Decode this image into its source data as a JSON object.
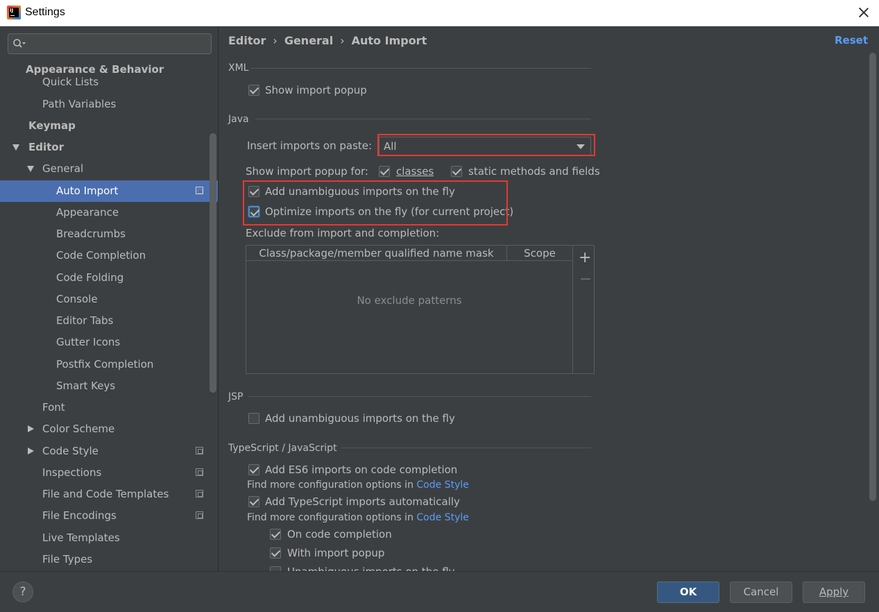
{
  "window": {
    "title": "Settings"
  },
  "sidebar": {
    "search_placeholder": "",
    "items": [
      {
        "label": "Appearance & Behavior"
      },
      {
        "label": "Quick Lists"
      },
      {
        "label": "Path Variables"
      },
      {
        "label": "Keymap"
      },
      {
        "label": "Editor"
      },
      {
        "label": "General"
      },
      {
        "label": "Auto Import"
      },
      {
        "label": "Appearance"
      },
      {
        "label": "Breadcrumbs"
      },
      {
        "label": "Code Completion"
      },
      {
        "label": "Code Folding"
      },
      {
        "label": "Console"
      },
      {
        "label": "Editor Tabs"
      },
      {
        "label": "Gutter Icons"
      },
      {
        "label": "Postfix Completion"
      },
      {
        "label": "Smart Keys"
      },
      {
        "label": "Font"
      },
      {
        "label": "Color Scheme"
      },
      {
        "label": "Code Style"
      },
      {
        "label": "Inspections"
      },
      {
        "label": "File and Code Templates"
      },
      {
        "label": "File Encodings"
      },
      {
        "label": "Live Templates"
      },
      {
        "label": "File Types"
      }
    ]
  },
  "breadcrumb": {
    "part1": "Editor",
    "part2": "General",
    "part3": "Auto Import",
    "sep": "›"
  },
  "header": {
    "reset_label": "Reset"
  },
  "xml": {
    "section_title": "XML",
    "show_import_popup": {
      "label": "Show import popup",
      "checked": true
    }
  },
  "java": {
    "section_title": "Java",
    "insert_imports_label": "Insert imports on paste:",
    "insert_imports_value": "All",
    "show_popup_for_label": "Show import popup for:",
    "classes": {
      "label": "classes",
      "checked": true
    },
    "static_methods": {
      "label": "static methods and fields",
      "checked": true
    },
    "add_unambiguous": {
      "label": "Add unambiguous imports on the fly",
      "checked": true
    },
    "optimize_imports": {
      "label": "Optimize imports on the fly (for current project)",
      "checked": true
    },
    "exclude_label": "Exclude from import and completion:",
    "table": {
      "columns": [
        "Class/package/member qualified name mask",
        "Scope"
      ],
      "empty_text": "No exclude patterns",
      "add_symbol": "+",
      "remove_symbol": "−"
    }
  },
  "jsp": {
    "section_title": "JSP",
    "add_unambiguous": {
      "label": "Add unambiguous imports on the fly",
      "checked": false
    }
  },
  "ts": {
    "section_title": "TypeScript / JavaScript",
    "add_es6": {
      "label": "Add ES6 imports on code completion",
      "checked": true
    },
    "find_more_1": "Find more configuration options in",
    "code_style_link_1": "Code Style",
    "add_ts_auto": {
      "label": "Add TypeScript imports automatically",
      "checked": true
    },
    "find_more_2": "Find more configuration options in",
    "code_style_link_2": "Code Style",
    "on_code_completion": {
      "label": "On code completion",
      "checked": true
    },
    "with_import_popup": {
      "label": "With import popup",
      "checked": true
    },
    "unambiguous_partial": {
      "label": "Unambiguous imports on the fly",
      "checked": false
    }
  },
  "footer": {
    "help_label": "?",
    "ok_label": "OK",
    "cancel_label": "Cancel",
    "apply_label": "Apply"
  },
  "colors": {
    "background": "#3c3f41",
    "selection": "#4b6eaf",
    "link": "#589df6",
    "highlight_box": "#e53935",
    "primary_button": "#365880"
  }
}
